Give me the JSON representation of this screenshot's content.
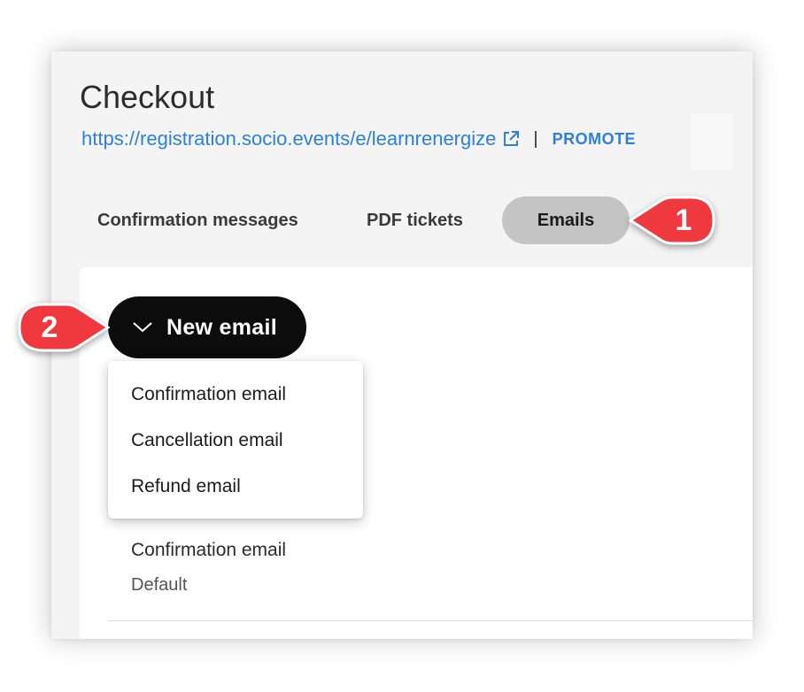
{
  "page": {
    "title": "Checkout",
    "url": "https://registration.socio.events/e/learnrenergize",
    "separator": "|",
    "promote_label": "PROMOTE"
  },
  "tabs": [
    {
      "label": "Confirmation messages",
      "active": false
    },
    {
      "label": "PDF tickets",
      "active": false
    },
    {
      "label": "Emails",
      "active": true
    }
  ],
  "new_email": {
    "label": "New email",
    "menu": [
      {
        "label": "Confirmation email"
      },
      {
        "label": "Cancellation email"
      },
      {
        "label": "Refund email"
      }
    ]
  },
  "emails": [
    {
      "name": "Confirmation email",
      "status": "Default"
    }
  ],
  "callouts": [
    {
      "number": "1"
    },
    {
      "number": "2"
    }
  ],
  "colors": {
    "link": "#2d7fe0",
    "callout": "#f0393f",
    "button": "#0c0c0c",
    "active_tab": "#c4c4c4"
  },
  "icons": {
    "external_link": "external-link-icon",
    "chevron": "chevron-down-icon"
  }
}
